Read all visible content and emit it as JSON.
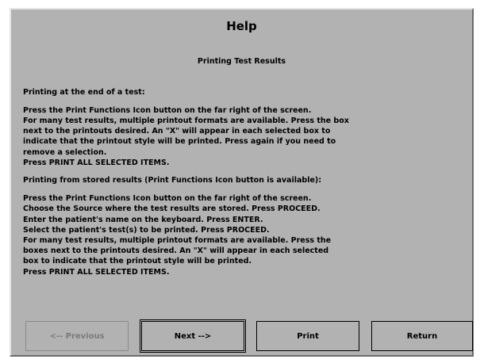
{
  "window": {
    "title": "Help",
    "subtitle": "Printing Test Results"
  },
  "content": {
    "p1": "Printing at the end of a test:",
    "p2": "Press the Print Functions Icon button on the far right of the screen.\nFor many test results, multiple printout formats are available. Press the box\nnext to the printouts desired. An \"X\" will appear in each selected box to\nindicate that the printout style will be printed. Press again if you need to\nremove a selection.\nPress PRINT ALL SELECTED ITEMS.",
    "p3": "Printing from stored results (Print Functions Icon button is available):",
    "p4": "Press the Print Functions Icon button on the far right of the screen.\nChoose the Source where the test results are stored. Press PROCEED.\nEnter the patient's name on the keyboard. Press ENTER.\nSelect the patient's test(s) to be printed. Press PROCEED.\nFor many test results, multiple printout formats are available. Press the\nboxes next to the printouts desired. An \"X\" will appear in each selected\nbox to indicate that the printout style will be printed.\nPress PRINT ALL SELECTED ITEMS."
  },
  "buttons": {
    "previous": "<-- Previous",
    "next": "Next -->",
    "print": "Print",
    "return": "Return"
  }
}
